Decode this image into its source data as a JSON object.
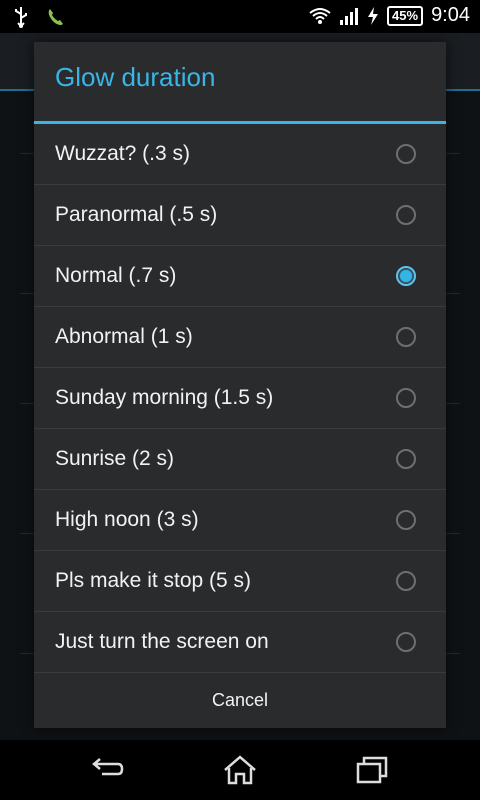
{
  "status_bar": {
    "battery": "45%",
    "time": "9:04",
    "icons": [
      "usb-icon",
      "phone-icon",
      "wifi-icon",
      "signal-icon",
      "charging-icon"
    ]
  },
  "dialog": {
    "title": "Glow duration",
    "options": [
      {
        "label": "Wuzzat? (.3 s)",
        "checked": false
      },
      {
        "label": "Paranormal (.5 s)",
        "checked": false
      },
      {
        "label": "Normal (.7 s)",
        "checked": true
      },
      {
        "label": "Abnormal (1 s)",
        "checked": false
      },
      {
        "label": "Sunday morning (1.5 s)",
        "checked": false
      },
      {
        "label": "Sunrise (2 s)",
        "checked": false
      },
      {
        "label": "High noon (3 s)",
        "checked": false
      },
      {
        "label": "Pls make it stop (5 s)",
        "checked": false
      },
      {
        "label": "Just turn the screen on",
        "checked": false
      }
    ],
    "cancel_label": "Cancel"
  },
  "colors": {
    "accent": "#33b5e5",
    "dialog_bg": "#2a2b2d"
  },
  "nav_bar": {
    "icons": [
      "back-icon",
      "home-icon",
      "recent-apps-icon"
    ]
  }
}
